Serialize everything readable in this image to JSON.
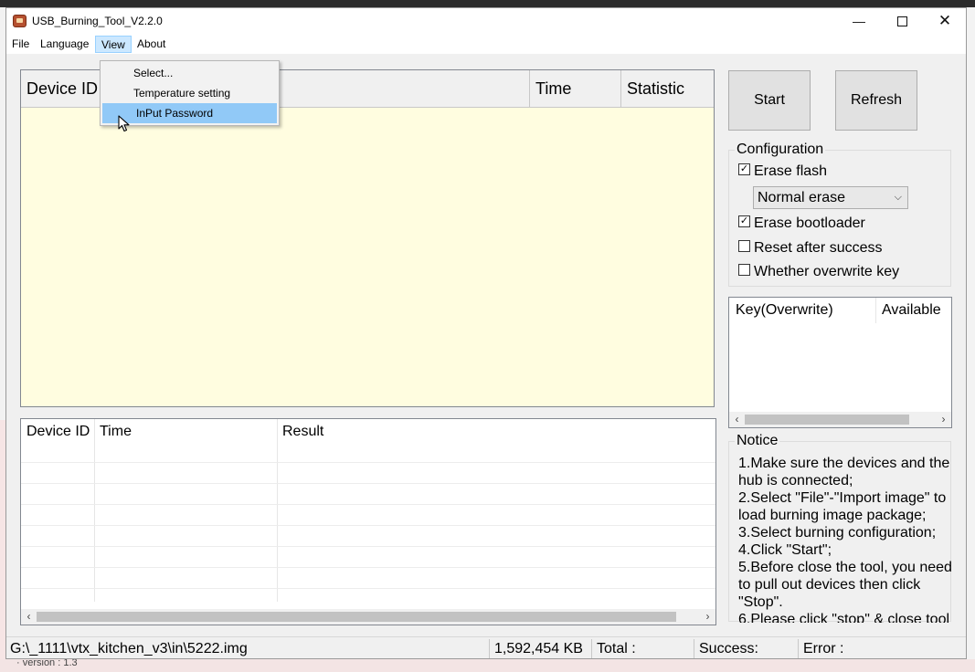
{
  "window": {
    "title": "USB_Burning_Tool_V2.2.0",
    "controls": {
      "minimize": "—",
      "close": "✕"
    }
  },
  "menubar": [
    "File",
    "Language",
    "View",
    "About"
  ],
  "view_menu": {
    "items": [
      "Select...",
      "Temperature setting",
      "InPut Password"
    ],
    "highlighted": "InPut Password"
  },
  "device_table": {
    "columns": [
      "Device ID",
      "Time",
      "Statistic"
    ],
    "background": "#fffde0"
  },
  "result_table": {
    "columns": [
      "Device ID",
      "Time",
      "Result"
    ],
    "rows": []
  },
  "buttons": {
    "start": "Start",
    "refresh": "Refresh"
  },
  "configuration": {
    "title": "Configuration",
    "erase_flash": {
      "label": "Erase flash",
      "checked": true
    },
    "erase_mode": "Normal erase",
    "erase_bootloader": {
      "label": "Erase bootloader",
      "checked": true
    },
    "reset_after_success": {
      "label": "Reset after success",
      "checked": false
    },
    "overwrite_key": {
      "label": "Whether overwrite key",
      "checked": false
    }
  },
  "key_table": {
    "columns": [
      "Key(Overwrite)",
      "Available"
    ]
  },
  "notice": {
    "title": "Notice",
    "lines": [
      "1.Make sure the devices and the hub is connected;",
      "2.Select \"File\"-\"Import image\" to load burning image package;",
      "3.Select burning configuration;",
      "4.Click \"Start\";",
      "5.Before close the tool, you need to pull out devices then click \"Stop\".",
      "6.Please click \"stop\" & close tool"
    ]
  },
  "statusbar": {
    "path": "G:\\_1111\\vtx_kitchen_v3\\in\\5222.img",
    "size": "1,592,454 KB",
    "total": "Total :",
    "success": "Success:",
    "error": "Error :"
  },
  "background_text": {
    "bottom": "· version    : 1.3"
  },
  "colors": {
    "menu_highlight": "#91c9f7",
    "view_menu_active": "#cce8ff"
  }
}
